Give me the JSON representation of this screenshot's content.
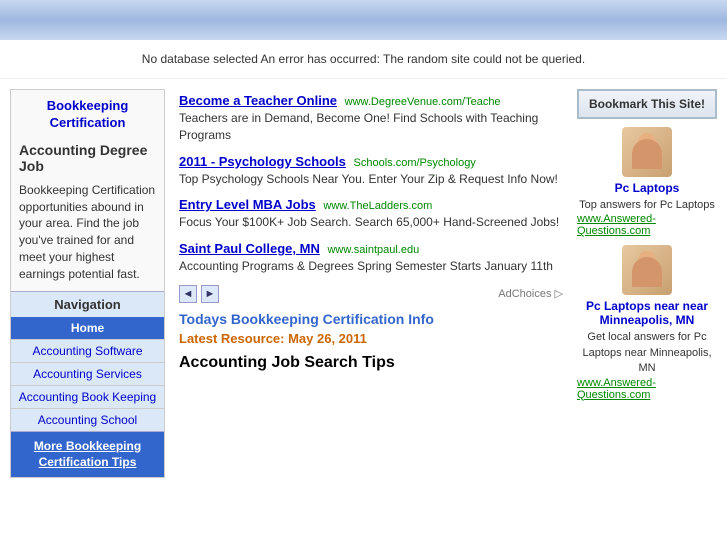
{
  "header": {
    "bg": "gradient blue"
  },
  "error": {
    "message": "No database selected An error has occurred: The random site could not be queried."
  },
  "sidebar": {
    "title": "Bookkeeping Certification",
    "title2": "Accounting Degree Job",
    "description": "Bookkeeping Certification opportunities abound in your area. Find the job you've trained for and meet your highest earnings potential fast.",
    "nav": {
      "header": "Navigation",
      "home": "Home",
      "items": [
        "Accounting Software",
        "Accounting Services",
        "Accounting Book Keeping",
        "Accounting School"
      ],
      "highlight": "More Bookkeeping Certification Tips"
    }
  },
  "ads": [
    {
      "link": "Become a Teacher Online",
      "url": "www.DegreeVenue.com/Teache",
      "description": "Teachers are in Demand, Become One! Find Schools with Teaching Programs"
    },
    {
      "link": "2011 - Psychology Schools",
      "url": "Schools.com/Psychology",
      "description": "Top Psychology Schools Near You. Enter Your Zip & Request Info Now!"
    },
    {
      "link": "Entry Level MBA Jobs",
      "url": "www.TheLadders.com",
      "description": "Focus Your $100K+ Job Search. Search 65,000+ Hand-Screened Jobs!"
    },
    {
      "link": "Saint Paul College, MN",
      "url": "www.saintpaul.edu",
      "description": "Accounting Programs & Degrees Spring Semester Starts January 11th"
    }
  ],
  "ad_choices_label": "AdChoices ▷",
  "nav_prev": "◄",
  "nav_next": "►",
  "section_title": "Todays Bookkeeping Certification Info",
  "latest_resource": "Latest Resource: May 26, 2011",
  "page_heading": "Accounting Job Search Tips",
  "right_sidebar": {
    "bookmark_label": "Bookmark This Site!",
    "ad1": {
      "title": "Pc Laptops",
      "desc1": "Top answers for Pc Laptops",
      "link": "www.Answered-Questions.com"
    },
    "ad2": {
      "title": "Pc Laptops",
      "subtitle": "near Minneapolis, MN",
      "desc1": "Get local answers for Pc",
      "desc2": "Laptops near Minneapolis, MN",
      "link": "www.Answered-Questions.com"
    }
  }
}
